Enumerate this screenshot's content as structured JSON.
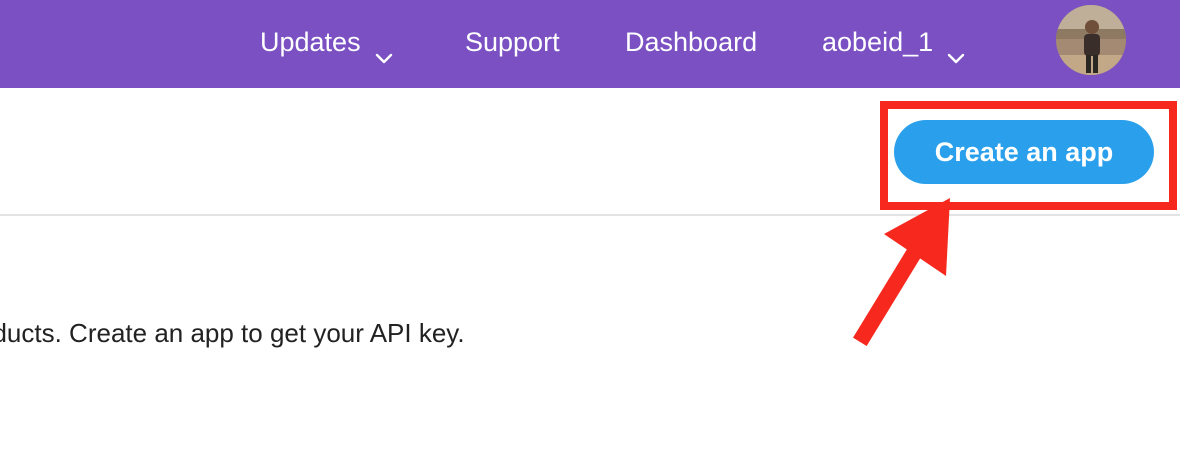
{
  "nav": {
    "items": [
      {
        "label": "Updates",
        "has_dropdown": true
      },
      {
        "label": "Support",
        "has_dropdown": false
      },
      {
        "label": "Dashboard",
        "has_dropdown": false
      },
      {
        "label": "aobeid_1",
        "has_dropdown": true
      }
    ],
    "background_color": "#7a50c2",
    "avatar_icon": "user-avatar"
  },
  "toolbar": {
    "create_app_label": "Create an app",
    "button_color": "#2aa0ec"
  },
  "annotation": {
    "highlight_color": "#f7291e"
  },
  "main": {
    "intro_text": "oducts. Create an app to get your API key."
  }
}
